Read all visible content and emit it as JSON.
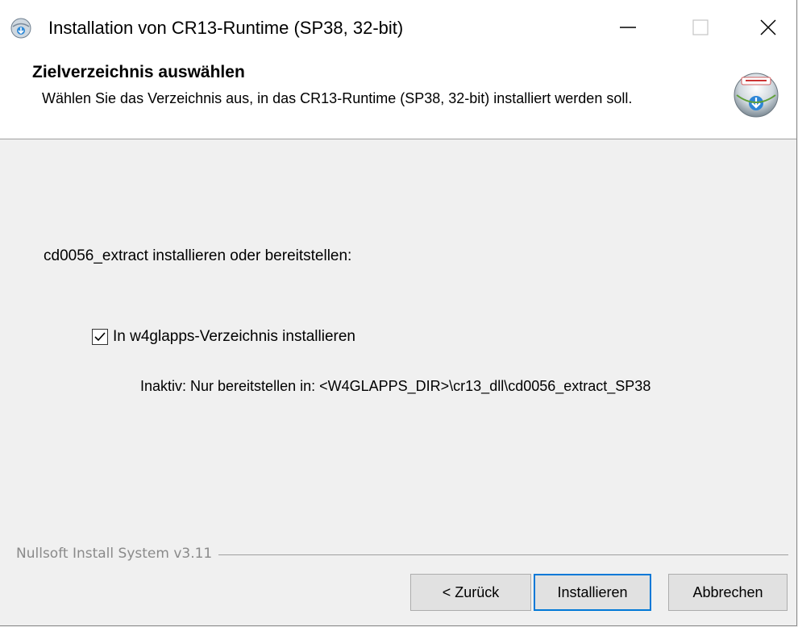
{
  "window": {
    "title": "Installation von CR13-Runtime (SP38, 32-bit)",
    "controls": {
      "minimize": "—",
      "close": "✕"
    }
  },
  "header": {
    "title": "Zielverzeichnis auswählen",
    "subtitle": "Wählen Sie das Verzeichnis aus, in das CR13-Runtime (SP38, 32-bit)  installiert werden soll."
  },
  "content": {
    "intro_label": "cd0056_extract installieren oder bereitstellen:",
    "checkbox": {
      "label": "In w4glapps-Verzeichnis installieren",
      "checked": true
    },
    "info_text": "Inaktiv: Nur bereitstellen in: <W4GLAPPS_DIR>\\cr13_dll\\cd0056_extract_SP38"
  },
  "footer": {
    "branding": "Nullsoft Install System v3.11",
    "buttons": {
      "back": "< Zurück",
      "install": "Installieren",
      "cancel": "Abbrechen"
    }
  },
  "colors": {
    "window_bg": "#f0f0f0",
    "header_bg": "#ffffff",
    "default_button_border": "#0078d7",
    "branding_text": "#8a8a8a"
  },
  "icons": {
    "app": "installer-globe-icon",
    "header": "installer-disk-icon",
    "checkmark": "checkmark-icon"
  }
}
